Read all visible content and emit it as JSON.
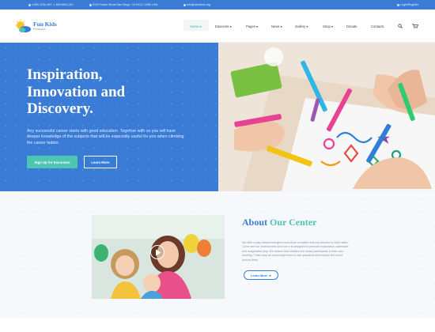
{
  "topbar": {
    "phone": "1-800-1234-567, 1-800-6541-321",
    "address": "2130 Fulton Street San Diego, CA 94117-1080 USA",
    "email": "info@demolink.org",
    "login": "Login/Register"
  },
  "brand": {
    "name": "Fun Kids",
    "tagline": "Preschool"
  },
  "nav": {
    "items": [
      "Home",
      "Elements",
      "Pages",
      "News",
      "Gallery",
      "Shop",
      "Donate",
      "Contacts"
    ]
  },
  "hero": {
    "title_line1": "Inspiration,",
    "title_line2": "Innovation and",
    "title_line3": "Discovery.",
    "text": "Any successful career starts with good education. Together with us you will have deeper knowledge of the subjects that will be especially useful for you when climbing the career ladder.",
    "primary_button": "Sign Up for Excursion",
    "secondary_button": "Learn More"
  },
  "about": {
    "title_part1": "About",
    "title_part2": "Our Center",
    "text": "We offer a play-based emergent curriculum complete with low teacher to child ratios. Come see our environment and how it is designed to promote exploration, adventure and imaginative play. We believe that children are active participants in their own learning. That's why we encourage them to ask questions and explore the world around them.",
    "button": "Learn More"
  },
  "colors": {
    "primary": "#3a7bd5",
    "accent": "#4cc5b1"
  },
  "icons": {
    "phone": "phone-icon",
    "location": "location-icon",
    "email": "email-icon",
    "user": "user-icon",
    "search": "search-icon",
    "cart": "cart-icon",
    "play": "play-icon"
  }
}
